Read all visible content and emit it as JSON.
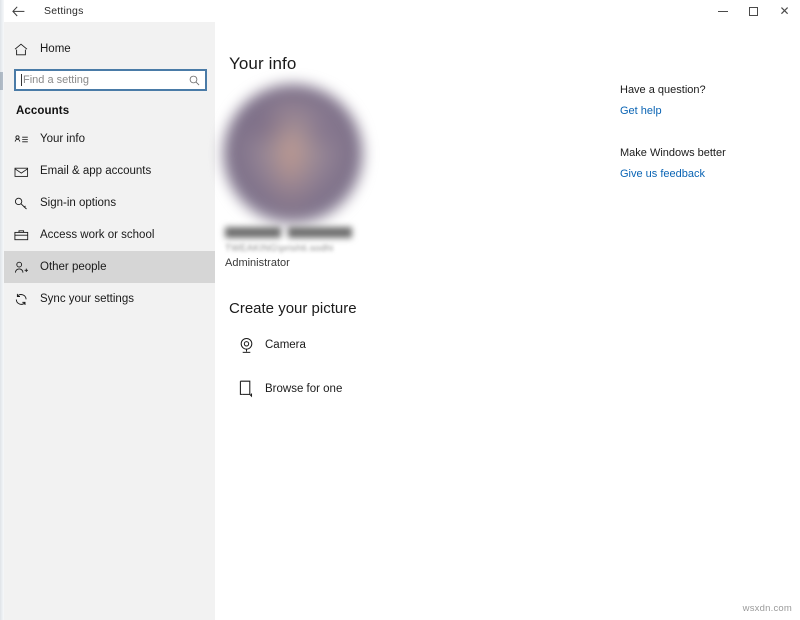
{
  "window": {
    "title": "Settings",
    "back_icon": "back-arrow-icon",
    "controls": {
      "minimize": "minimize-icon",
      "maximize": "maximize-icon",
      "close": "close-icon"
    }
  },
  "sidebar": {
    "home": {
      "label": "Home",
      "icon": "home-icon"
    },
    "search": {
      "placeholder": "Find a setting",
      "value": "",
      "icon": "search-icon"
    },
    "group_header": "Accounts",
    "items": [
      {
        "label": "Your info",
        "icon": "id-card-icon",
        "state": "selected"
      },
      {
        "label": "Email & app accounts",
        "icon": "envelope-icon",
        "state": "normal"
      },
      {
        "label": "Sign-in options",
        "icon": "key-icon",
        "state": "normal"
      },
      {
        "label": "Access work or school",
        "icon": "briefcase-icon",
        "state": "normal"
      },
      {
        "label": "Other people",
        "icon": "person-add-icon",
        "state": "hovered"
      },
      {
        "label": "Sync your settings",
        "icon": "sync-icon",
        "state": "normal"
      }
    ]
  },
  "main": {
    "page_title": "Your info",
    "account": {
      "name": "",
      "name_redacted": true,
      "domain_user": "TWEAKING\\prishti.sodhi",
      "role": "Administrator",
      "avatar": "user-avatar-blurred"
    },
    "create_picture": {
      "heading": "Create your picture",
      "actions": [
        {
          "label": "Camera",
          "icon": "camera-icon"
        },
        {
          "label": "Browse for one",
          "icon": "browse-file-icon"
        }
      ]
    }
  },
  "help_rail": {
    "groups": [
      {
        "heading": "Have a question?",
        "link": "Get help"
      },
      {
        "heading": "Make Windows better",
        "link": "Give us feedback"
      }
    ]
  },
  "watermark": "wsxdn.com",
  "colors": {
    "accent_selected": "#22406b",
    "link": "#0a64b4",
    "sidebar_bg": "#f2f2f2",
    "hover_bg": "#d6d6d6",
    "search_border": "#4a7ba7"
  }
}
